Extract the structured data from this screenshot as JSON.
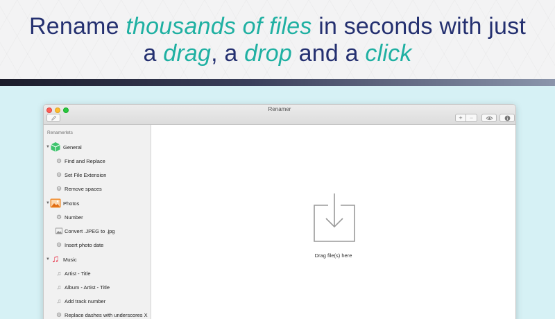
{
  "hero": {
    "line1_a": "Rename ",
    "line1_hl": "thousands of files",
    "line1_b": " in seconds with just",
    "line2_a": "a ",
    "line2_hl1": "drag",
    "line2_b": ", a ",
    "line2_hl2": "drop",
    "line2_c": " and a ",
    "line2_hl3": "click",
    "text_color": "#243070",
    "highlight_color": "#1fb0a2"
  },
  "window": {
    "title": "Renamer",
    "toolbar": {
      "edit_icon": "pencil-icon",
      "add_label": "+",
      "remove_label": "−",
      "preview_icon": "eye-icon",
      "info_label": "i"
    }
  },
  "sidebar": {
    "header": "Renamerlets",
    "groups": [
      {
        "label": "General",
        "icon": "cube-icon",
        "color": "#3ec46d",
        "items": [
          {
            "label": "Find and Replace",
            "icon": "gear-icon"
          },
          {
            "label": "Set File Extension",
            "icon": "gear-icon"
          },
          {
            "label": "Remove spaces",
            "icon": "gear-icon"
          }
        ]
      },
      {
        "label": "Photos",
        "icon": "photo-icon",
        "color": "#f08a2a",
        "items": [
          {
            "label": "Number",
            "icon": "gear-icon"
          },
          {
            "label": "Convert .JPEG to .jpg",
            "icon": "image-icon"
          },
          {
            "label": "Insert photo date",
            "icon": "gear-icon"
          }
        ]
      },
      {
        "label": "Music",
        "icon": "music-note-icon",
        "color": "#e8354b",
        "items": [
          {
            "label": "Artist - Title",
            "icon": "music-note-icon"
          },
          {
            "label": "Album - Artist - Title",
            "icon": "music-note-icon"
          },
          {
            "label": "Add track number",
            "icon": "music-note-icon"
          },
          {
            "label": "Replace dashes with underscores X",
            "icon": "gear-icon"
          }
        ]
      }
    ]
  },
  "dropzone": {
    "label": "Drag file(s) here",
    "icon": "download-tray-icon"
  }
}
